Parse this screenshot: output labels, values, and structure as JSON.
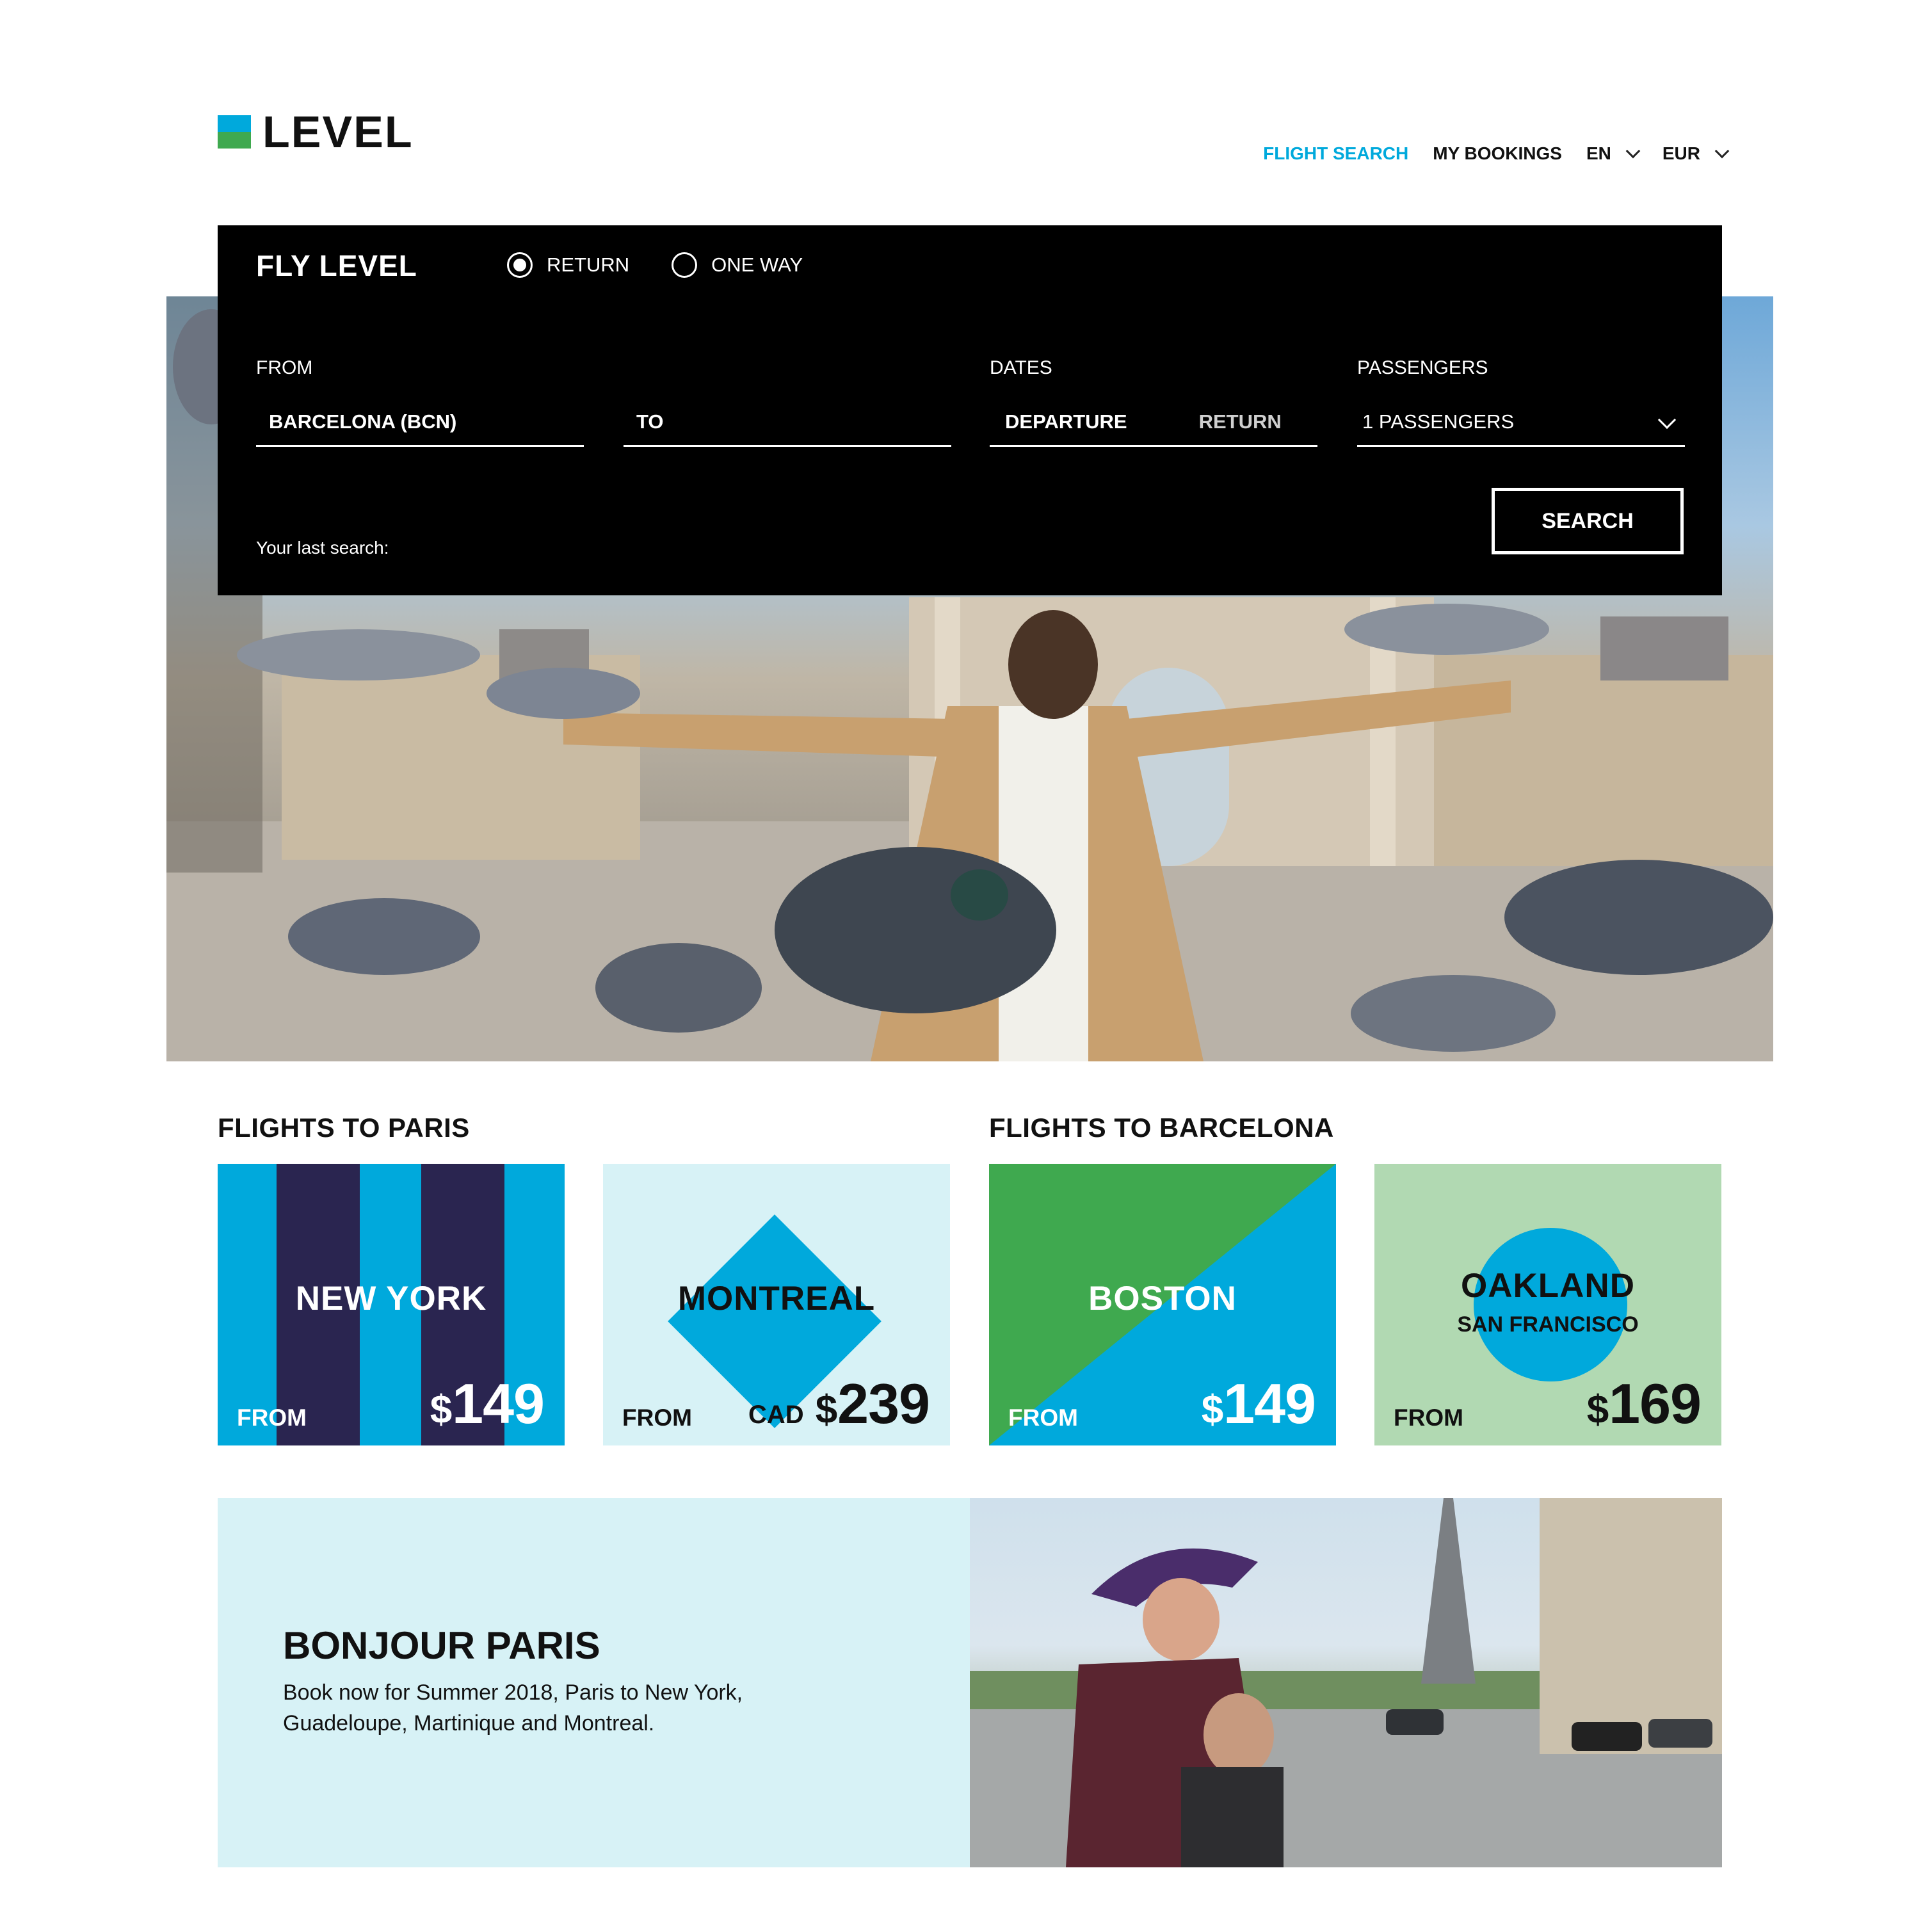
{
  "brand": {
    "name": "LEVEL",
    "colors": {
      "blue": "#00a9dc",
      "green": "#3fa94f",
      "dark": "#2a2550"
    }
  },
  "nav": {
    "flight_search": "FLIGHT SEARCH",
    "my_bookings": "MY BOOKINGS",
    "language": "EN",
    "currency": "EUR"
  },
  "search": {
    "title": "FLY LEVEL",
    "trip_types": {
      "return": "RETURN",
      "one_way": "ONE WAY",
      "selected": "return"
    },
    "from_label": "FROM",
    "from_value": "BARCELONA (BCN)",
    "to_placeholder": "TO",
    "dates_label": "DATES",
    "departure": "DEPARTURE",
    "return": "RETURN",
    "passengers_label": "PASSENGERS",
    "passengers_value": "1 PASSENGERS",
    "search_button": "SEARCH",
    "last_search": "Your last search:"
  },
  "sections": {
    "paris": "FLIGHTS TO PARIS",
    "barcelona": "FLIGHTS TO BARCELONA"
  },
  "cards": [
    {
      "city": "NEW YORK",
      "from": "FROM",
      "currency": "",
      "symbol": "$",
      "amount": "149"
    },
    {
      "city": "MONTREAL",
      "from": "FROM",
      "currency": "CAD",
      "symbol": "$",
      "amount": "239"
    },
    {
      "city": "BOSTON",
      "from": "FROM",
      "currency": "",
      "symbol": "$",
      "amount": "149"
    },
    {
      "city": "OAKLAND",
      "subtitle": "SAN FRANCISCO",
      "from": "FROM",
      "currency": "",
      "symbol": "$",
      "amount": "169"
    }
  ],
  "promo": {
    "title": "BONJOUR PARIS",
    "text": "Book now for Summer 2018, Paris to New York, Guadeloupe, Martinique and Montreal."
  }
}
